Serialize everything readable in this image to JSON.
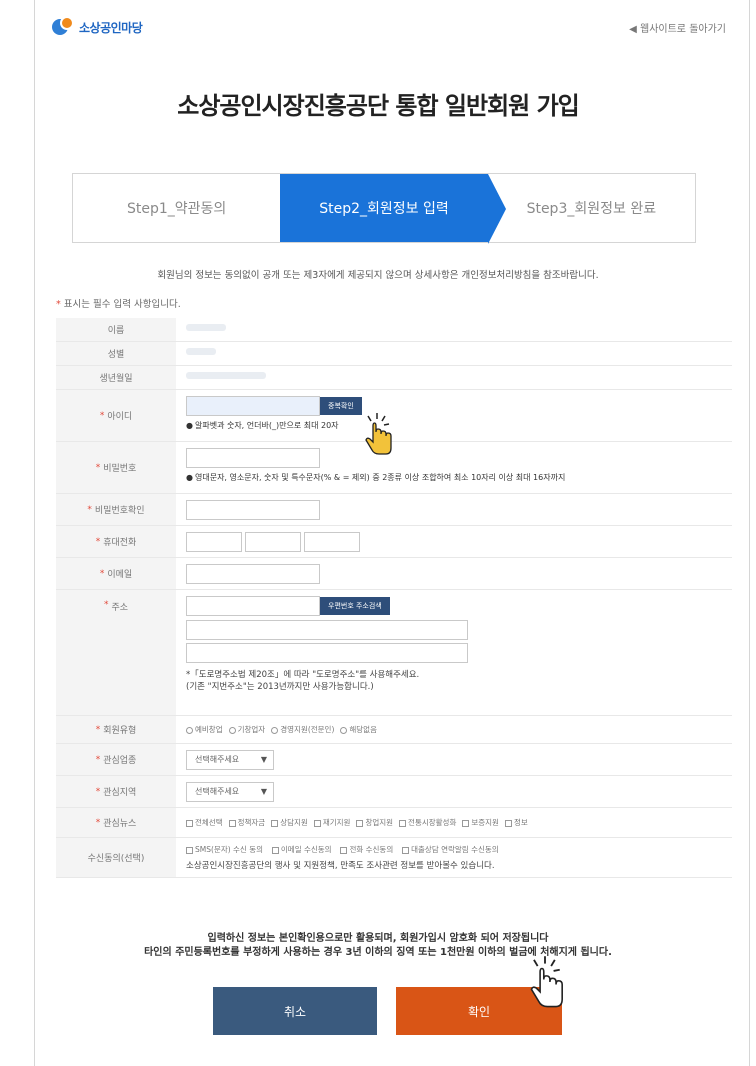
{
  "header": {
    "logo_text": "소상공인마당",
    "back_link": "◀ 웹사이트로 돌아가기"
  },
  "title": "소상공인시장진흥공단 통합 일반회원 가입",
  "steps": [
    {
      "label": "Step1_약관동의"
    },
    {
      "label": "Step2_회원정보 입력"
    },
    {
      "label": "Step3_회원정보 완료"
    }
  ],
  "notice": "회원님의 정보는 동의없이 공개 또는 제3자에게 제공되지 않으며 상세사항은 개인정보처리방침을 참조바랍니다.",
  "required_note": "표시는 필수 입력 사항입니다.",
  "form": {
    "name_label": "이름",
    "gender_label": "성별",
    "birth_label": "생년월일",
    "id_label": "아이디",
    "id_check_button": "중복확인",
    "id_hint": "알파벳과 숫자, 언더바(_)만으로 최대 20자",
    "pw_label": "비밀번호",
    "pw_hint": "영대문자, 영소문자, 숫자 및 특수문자(% & = 제외) 중 2종류 이상 조합하여 최소 10자리 이상 최대 16자까지",
    "pw_confirm_label": "비밀번호확인",
    "phone_label": "휴대전화",
    "email_label": "이메일",
    "address_label": "주소",
    "address_search_button": "우편번호 주소검색",
    "address_note_1": "*「도로명주소법 제20조」에 따라 \"도로명주소\"를 사용해주세요.",
    "address_note_2": "(기존 \"지번주소\"는 2013년까지만 사용가능합니다.)",
    "member_type_label": "회원유형",
    "member_types": [
      "예비창업",
      "기창업자",
      "경영지원(전문인)",
      "해당없음"
    ],
    "interest_field_label": "관심업종",
    "interest_field_value": "선택해주세요",
    "interest_region_label": "관심지역",
    "interest_region_value": "선택해주세요",
    "interest_news_label": "관심뉴스",
    "interest_news": [
      "전체선택",
      "정책자금",
      "상담지원",
      "재기지원",
      "창업지원",
      "전통시장활성화",
      "보증지원",
      "정보"
    ],
    "consent_label": "수신동의(선택)",
    "consent_options": [
      "SMS(문자) 수신 동의",
      "이메일 수신동의",
      "전화 수신동의",
      "대출상담 연락알림 수신동의"
    ],
    "consent_desc": "소상공인시장진흥공단의 행사 및 지원정책, 만족도 조사관련 정보를 받아볼수 있습니다."
  },
  "bottom_note_1": "입력하신 정보는 본인확인용으로만 활용되며, 회원가입시 암호화 되어 저장됩니다",
  "bottom_note_2": "타인의 주민등록번호를 부정하게 사용하는 경우 3년 이하의 징역 또는 1천만원 이하의 벌금에 처해지게 됩니다.",
  "buttons": {
    "cancel": "취소",
    "confirm": "확인"
  },
  "colors": {
    "active_step": "#1a73d9",
    "cancel": "#3a5a7e",
    "confirm": "#d95516",
    "required_star": "#e2493a"
  }
}
